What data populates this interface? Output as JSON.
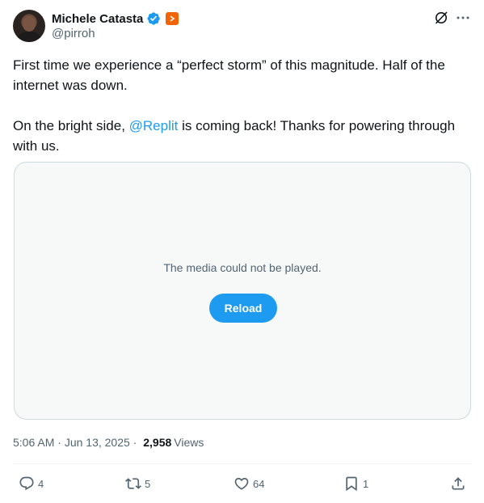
{
  "author": {
    "name": "Michele Catasta",
    "handle": "@pirroh",
    "verified": true,
    "affiliation_badge_color": "#f26207"
  },
  "tweet": {
    "line1": "First time we experience a “perfect storm” of this magnitude. Half of the internet was down.",
    "line2_before": "On the bright side, ",
    "mention": "@Replit",
    "line2_after": " is coming back! Thanks for powering through with us."
  },
  "media": {
    "message": "The media could not be played.",
    "reload_label": "Reload"
  },
  "meta": {
    "time": "5:06 AM",
    "sep1": " · ",
    "date": "Jun 13, 2025",
    "sep2": " · ",
    "views_count": "2,958",
    "views_label": "Views"
  },
  "actions": {
    "replies": "4",
    "reposts": "5",
    "likes": "64",
    "bookmarks": "1"
  },
  "icons": {
    "verified": "verified-badge-icon",
    "grok": "grok-icon",
    "more": "more-icon",
    "reply": "reply-icon",
    "repost": "repost-icon",
    "like": "heart-icon",
    "bookmark": "bookmark-icon",
    "share": "share-icon"
  },
  "colors": {
    "accent": "#1d9bf0",
    "text": "#0f1419",
    "muted": "#536471"
  }
}
